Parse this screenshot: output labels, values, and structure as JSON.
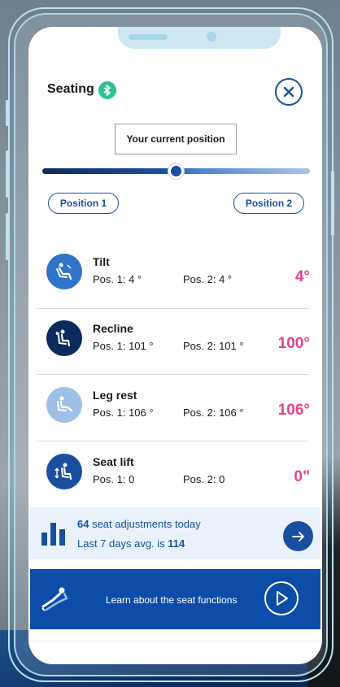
{
  "header": {
    "title": "Seating",
    "bluetooth_icon": "bluetooth-icon",
    "close_icon": "close-icon"
  },
  "slider": {
    "current_position_label": "Your current position",
    "value_fraction": 0.5,
    "position1_label": "Position 1",
    "position2_label": "Position 2"
  },
  "adjustments": [
    {
      "icon": "seat-tilt-icon",
      "title": "Tilt",
      "pos1": "Pos. 1: 4 °",
      "pos2": "Pos. 2: 4 °",
      "value": "4°",
      "icon_color": "#2f74c9"
    },
    {
      "icon": "seat-recline-icon",
      "title": "Recline",
      "pos1": "Pos. 1: 101 °",
      "pos2": "Pos. 2: 101 °",
      "value": "100°",
      "icon_color": "#0c2a5c"
    },
    {
      "icon": "leg-rest-icon",
      "title": "Leg rest",
      "pos1": "Pos. 1: 106 °",
      "pos2": "Pos. 2: 106 °",
      "value": "106°",
      "icon_color": "#9fc0e6"
    },
    {
      "icon": "seat-lift-icon",
      "title": "Seat lift",
      "pos1": "Pos. 1: 0",
      "pos2": "Pos. 2: 0",
      "value": "0\"",
      "icon_color": "#1a4fa0"
    }
  ],
  "stats": {
    "count": "64",
    "line1_suffix": " seat adjustments today",
    "line2_prefix": "Last 7 days avg. is ",
    "avg": "114",
    "icon": "bar-chart-icon",
    "arrow_icon": "arrow-right-icon"
  },
  "learn": {
    "text": "Learn about the seat functions",
    "play_icon": "play-icon"
  },
  "colors": {
    "accent": "#1a4fa0",
    "value_pink": "#e2448a",
    "bluetooth_green": "#2fc19a"
  }
}
